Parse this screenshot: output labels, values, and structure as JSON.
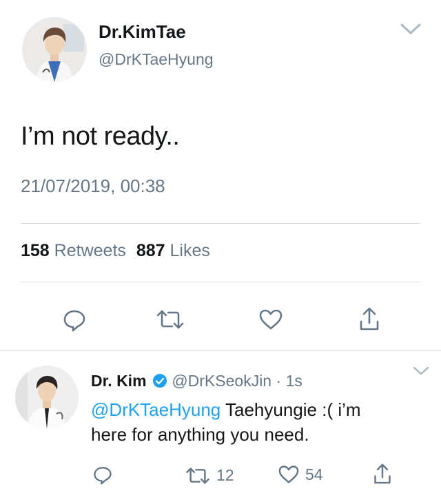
{
  "main_tweet": {
    "display_name": "Dr.KimTae",
    "handle": "@DrKTaeHyung",
    "text": "I’m not ready..",
    "timestamp": "21/07/2019, 00:38",
    "retweets_count": "158",
    "retweets_label": "Retweets",
    "likes_count": "887",
    "likes_label": "Likes",
    "icons": [
      "reply-icon",
      "retweet-icon",
      "like-icon",
      "share-icon",
      "chevron-down-icon"
    ]
  },
  "reply_tweet": {
    "display_name": "Dr. Kim",
    "handle": "@DrKSeokJin",
    "separator": "·",
    "time_ago": "1s",
    "mention": "@DrKTaeHyung",
    "text_line1": " Taehyungie :( i’m",
    "text_line2": "here for anything you need.",
    "retweet_count": "12",
    "like_count": "54",
    "verified_color": "#1da1f2",
    "icons": [
      "reply-icon",
      "retweet-icon",
      "like-icon",
      "share-icon",
      "chevron-down-icon",
      "verified-badge-icon"
    ]
  }
}
